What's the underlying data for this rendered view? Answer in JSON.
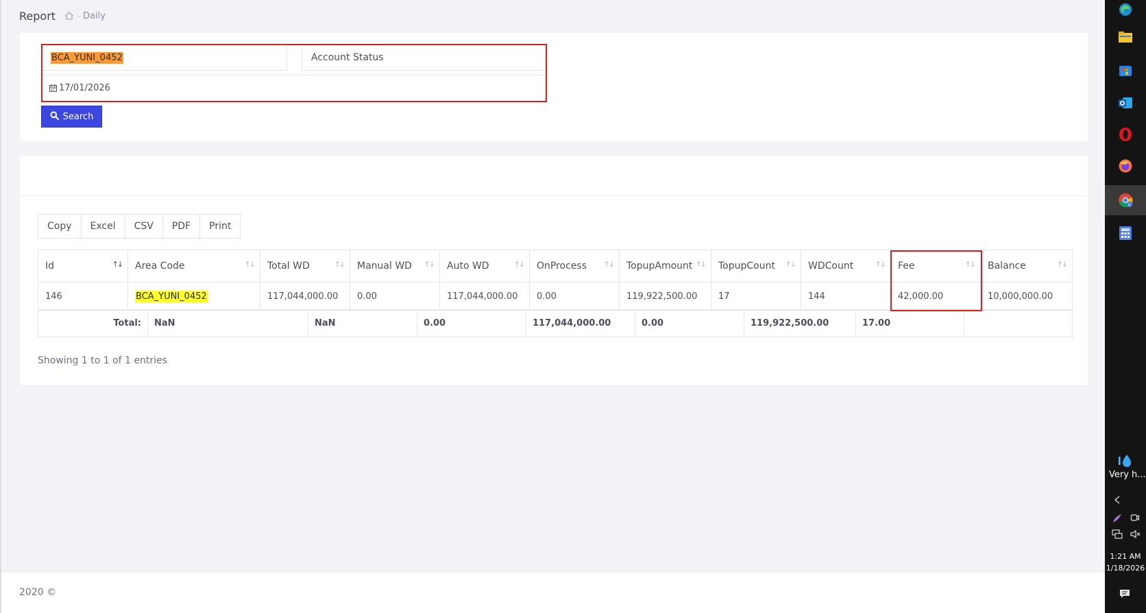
{
  "breadcrumb": {
    "title": "Report",
    "separator": "-",
    "current": "Daily"
  },
  "filters": {
    "area_code_value": "BCA_YUNI_0452",
    "account_status_placeholder": "Account Status",
    "date_value": "17/01/2026",
    "search_label": "Search"
  },
  "export_buttons": [
    "Copy",
    "Excel",
    "CSV",
    "PDF",
    "Print"
  ],
  "table": {
    "headers": [
      "Id",
      "Area Code",
      "Total WD",
      "Manual WD",
      "Auto WD",
      "OnProcess",
      "TopupAmount",
      "TopupCount",
      "WDCount",
      "Fee",
      "Balance"
    ],
    "rows": [
      [
        "146",
        "BCA_YUNI_0452",
        "117,044,000.00",
        "0.00",
        "117,044,000.00",
        "0.00",
        "119,922,500.00",
        "17",
        "144",
        "42,000.00",
        "10,000,000.00"
      ]
    ],
    "totals": {
      "label": "Total:",
      "values": [
        "NaN",
        "NaN",
        "0.00",
        "117,044,000.00",
        "0.00",
        "119,922,500.00",
        "17.00",
        ""
      ]
    },
    "info": "Showing 1 to 1 of 1 entries"
  },
  "footer": {
    "text": "2020 ©"
  },
  "taskbar": {
    "weather_text": "Very h...",
    "time": "1:21 AM",
    "date": "1/18/2026"
  },
  "colors": {
    "primary_button": "#3b47e0",
    "highlight_red": "#e01d1d",
    "area_highlight": "#ffff2b",
    "input_highlight": "#f79a3c"
  }
}
